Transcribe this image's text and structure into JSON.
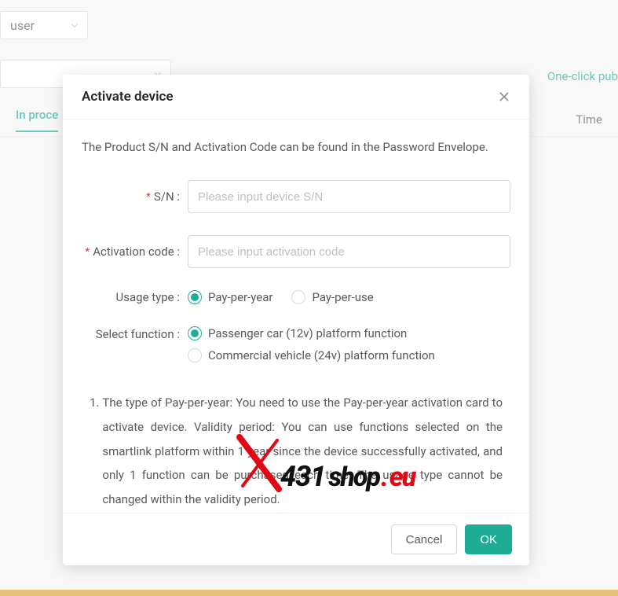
{
  "bg": {
    "select1": "user",
    "link": "One-click pub",
    "tab_active": "In proce",
    "tab_right": "Time"
  },
  "modal": {
    "title": "Activate device",
    "description": "The Product S/N and Activation Code can be found in the Password Envelope.",
    "fields": {
      "sn": {
        "label": "S/N :",
        "placeholder": "Please input device S/N",
        "required": true
      },
      "activation_code": {
        "label": "Activation code :",
        "placeholder": "Please input activation code",
        "required": true
      },
      "usage_type": {
        "label": "Usage type :",
        "options": [
          {
            "label": "Pay-per-year",
            "checked": true
          },
          {
            "label": "Pay-per-use",
            "checked": false
          }
        ]
      },
      "select_function": {
        "label": "Select function :",
        "options": [
          {
            "label": "Passenger car (12v) platform function",
            "checked": true
          },
          {
            "label": "Commercial vehicle (24v) platform function",
            "checked": false
          }
        ]
      }
    },
    "info": {
      "num": "1.",
      "text": "The type of Pay-per-year: You need to use the Pay-per-year activation card to activate device. Validity period: You can use functions selected on the smartlink platform within 1 year since the device successfully activated, and only 1 function can be purchased each time. The usage type cannot be changed within the validity period."
    },
    "buttons": {
      "cancel": "Cancel",
      "ok": "OK"
    }
  },
  "watermark": {
    "p1": "431",
    "p2": "shop",
    "dot": ".",
    "p3": "eu"
  }
}
